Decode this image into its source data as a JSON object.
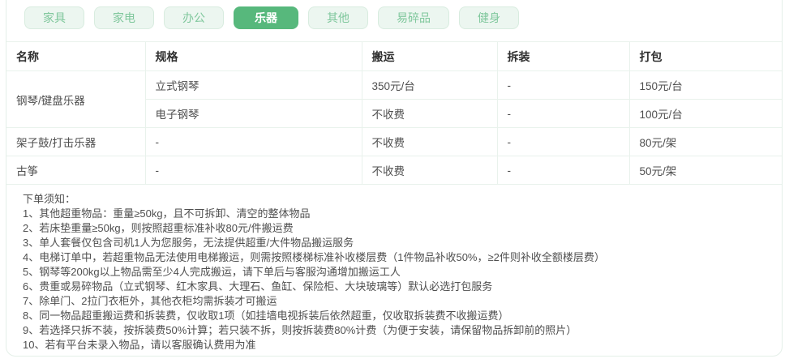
{
  "tabs": [
    {
      "id": "furniture",
      "label": "家具",
      "active": false
    },
    {
      "id": "appliance",
      "label": "家电",
      "active": false
    },
    {
      "id": "office",
      "label": "办公",
      "active": false
    },
    {
      "id": "instrument",
      "label": "乐器",
      "active": true
    },
    {
      "id": "other",
      "label": "其他",
      "active": false
    },
    {
      "id": "fragile",
      "label": "易碎品",
      "active": false
    },
    {
      "id": "fitness",
      "label": "健身",
      "active": false
    }
  ],
  "table": {
    "headers": [
      "名称",
      "规格",
      "搬运",
      "拆装",
      "打包"
    ],
    "rows": [
      {
        "cells": [
          {
            "text": "钢琴/键盘乐器",
            "rowspan": 2
          },
          {
            "text": "立式钢琴"
          },
          {
            "text": "350元/台"
          },
          {
            "text": "-"
          },
          {
            "text": "150元/台"
          }
        ]
      },
      {
        "cells": [
          {
            "text": "电子钢琴"
          },
          {
            "text": "不收费"
          },
          {
            "text": "-"
          },
          {
            "text": "100元/台"
          }
        ]
      },
      {
        "cells": [
          {
            "text": "架子鼓/打击乐器"
          },
          {
            "text": "-"
          },
          {
            "text": "不收费"
          },
          {
            "text": "-"
          },
          {
            "text": "80元/架"
          }
        ]
      },
      {
        "cells": [
          {
            "text": "古筝"
          },
          {
            "text": "-"
          },
          {
            "text": "不收费"
          },
          {
            "text": "-"
          },
          {
            "text": "50元/架"
          }
        ]
      }
    ]
  },
  "notes": {
    "title": "下单须知：",
    "items": [
      "1、其他超重物品：重量≥50kg，且不可拆卸、清空的整体物品",
      "2、若床垫重量≥50kg，则按照超重标准补收80元/件搬运费",
      "3、单人套餐仅包含司机1人为您服务，无法提供超重/大件物品搬运服务",
      "4、电梯订单中，若超重物品无法使用电梯搬运，则需按照楼梯标准补收楼层费（1件物品补收50%，≥2件则补收全额楼层费）",
      "5、钢琴等200kg以上物品需至少4人完成搬运，请下单后与客服沟通增加搬运工人",
      "6、贵重或易碎物品（立式钢琴、红木家具、大理石、鱼缸、保险柜、大块玻璃等）默认必选打包服务",
      "7、除单门、2拉门衣柜外，其他衣柜均需拆装才可搬运",
      "8、同一物品超重搬运费和拆装费，仅收取1项（如挂墙电视拆装后依然超重，仅收取拆装费不收搬运费）",
      "9、若选择只拆不装，按拆装费50%计算；若只装不拆，则按拆装费80%计费（为便于安装，请保留物品拆卸前的照片）",
      "10、若有平台未录入物品，请以客服确认费用为准"
    ]
  },
  "colors": {
    "accent_green": "#57b87c",
    "tab_inactive_bg": "#ecf6f0",
    "tab_inactive_border": "#d8ecdf",
    "tab_inactive_text": "#7fc79c",
    "table_border": "#e9f2ec",
    "card_border": "#e4efe8",
    "header_text": "#2f2f2f",
    "body_text": "#4f4f4f"
  }
}
